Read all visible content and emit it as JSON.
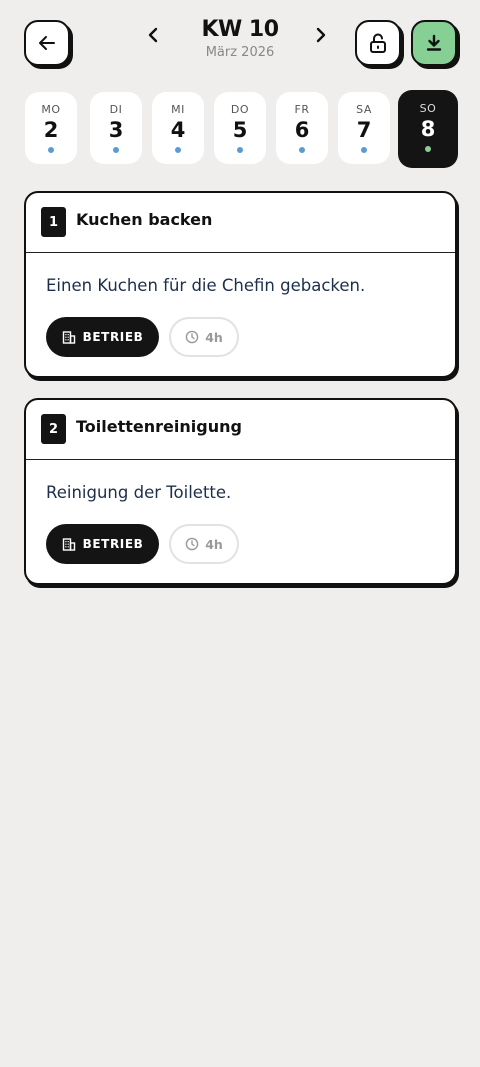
{
  "header": {
    "week_title": "KW 10",
    "month_label": "März 2026",
    "back_icon": "arrow-left-icon",
    "prev_icon": "chevron-left-icon",
    "next_icon": "chevron-right-icon",
    "lock_icon": "unlock-icon",
    "download_icon": "download-icon",
    "download_color": "#86cf95"
  },
  "days": [
    {
      "name": "MO",
      "date": "2",
      "dot_color": "#5b9bd5"
    },
    {
      "name": "DI",
      "date": "3",
      "dot_color": "#5b9bd5"
    },
    {
      "name": "MI",
      "date": "4",
      "dot_color": "#5b9bd5"
    },
    {
      "name": "DO",
      "date": "5",
      "dot_color": "#5b9bd5"
    },
    {
      "name": "FR",
      "date": "6",
      "dot_color": "#5b9bd5"
    },
    {
      "name": "SA",
      "date": "7",
      "dot_color": "#5b9bd5"
    },
    {
      "name": "SO",
      "date": "8",
      "dot_color": "#86cf95",
      "selected": true
    }
  ],
  "tasks": [
    {
      "number": "1",
      "title": "Kuchen backen",
      "description": "Einen Kuchen für die Chefin gebacken.",
      "category_label": "BETRIEB",
      "category_icon": "building-icon",
      "duration_label": "4h",
      "duration_icon": "clock-icon"
    },
    {
      "number": "2",
      "title": "Toilettenreinigung",
      "description": "Reinigung der Toilette.",
      "category_label": "BETRIEB",
      "category_icon": "building-icon",
      "duration_label": "4h",
      "duration_icon": "clock-icon"
    }
  ]
}
